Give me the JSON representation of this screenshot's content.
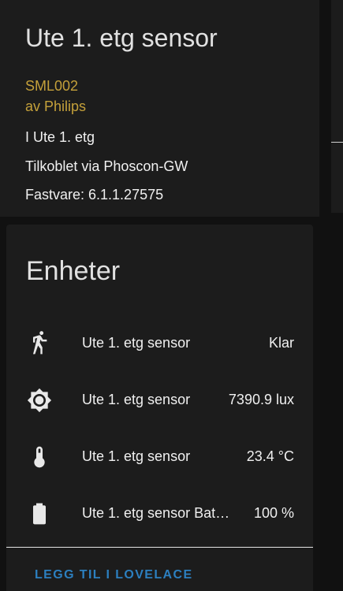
{
  "device": {
    "title": "Ute 1. etg sensor",
    "model": "SML002",
    "manufacturer": "av Philips",
    "area": "I Ute 1. etg",
    "connected_via": "Tilkoblet via Phoscon-GW",
    "firmware": "Fastvare: 6.1.1.27575"
  },
  "entities": {
    "title": "Enheter",
    "items": [
      {
        "icon": "walk-icon",
        "name": "Ute 1. etg sensor",
        "state": "Klar"
      },
      {
        "icon": "brightness-icon",
        "name": "Ute 1. etg sensor",
        "state": "7390.9 lux"
      },
      {
        "icon": "thermometer-icon",
        "name": "Ute 1. etg sensor",
        "state": "23.4 °C"
      },
      {
        "icon": "battery-icon",
        "name": "Ute 1. etg sensor Bat…",
        "state": "100 %"
      }
    ],
    "add_to_lovelace": "LEGG TIL I LOVELACE"
  },
  "colors": {
    "accent_gold": "#c4a03a",
    "button_blue": "#2c7fbf",
    "card_bg": "#1c1c1c",
    "page_bg": "#111111"
  }
}
